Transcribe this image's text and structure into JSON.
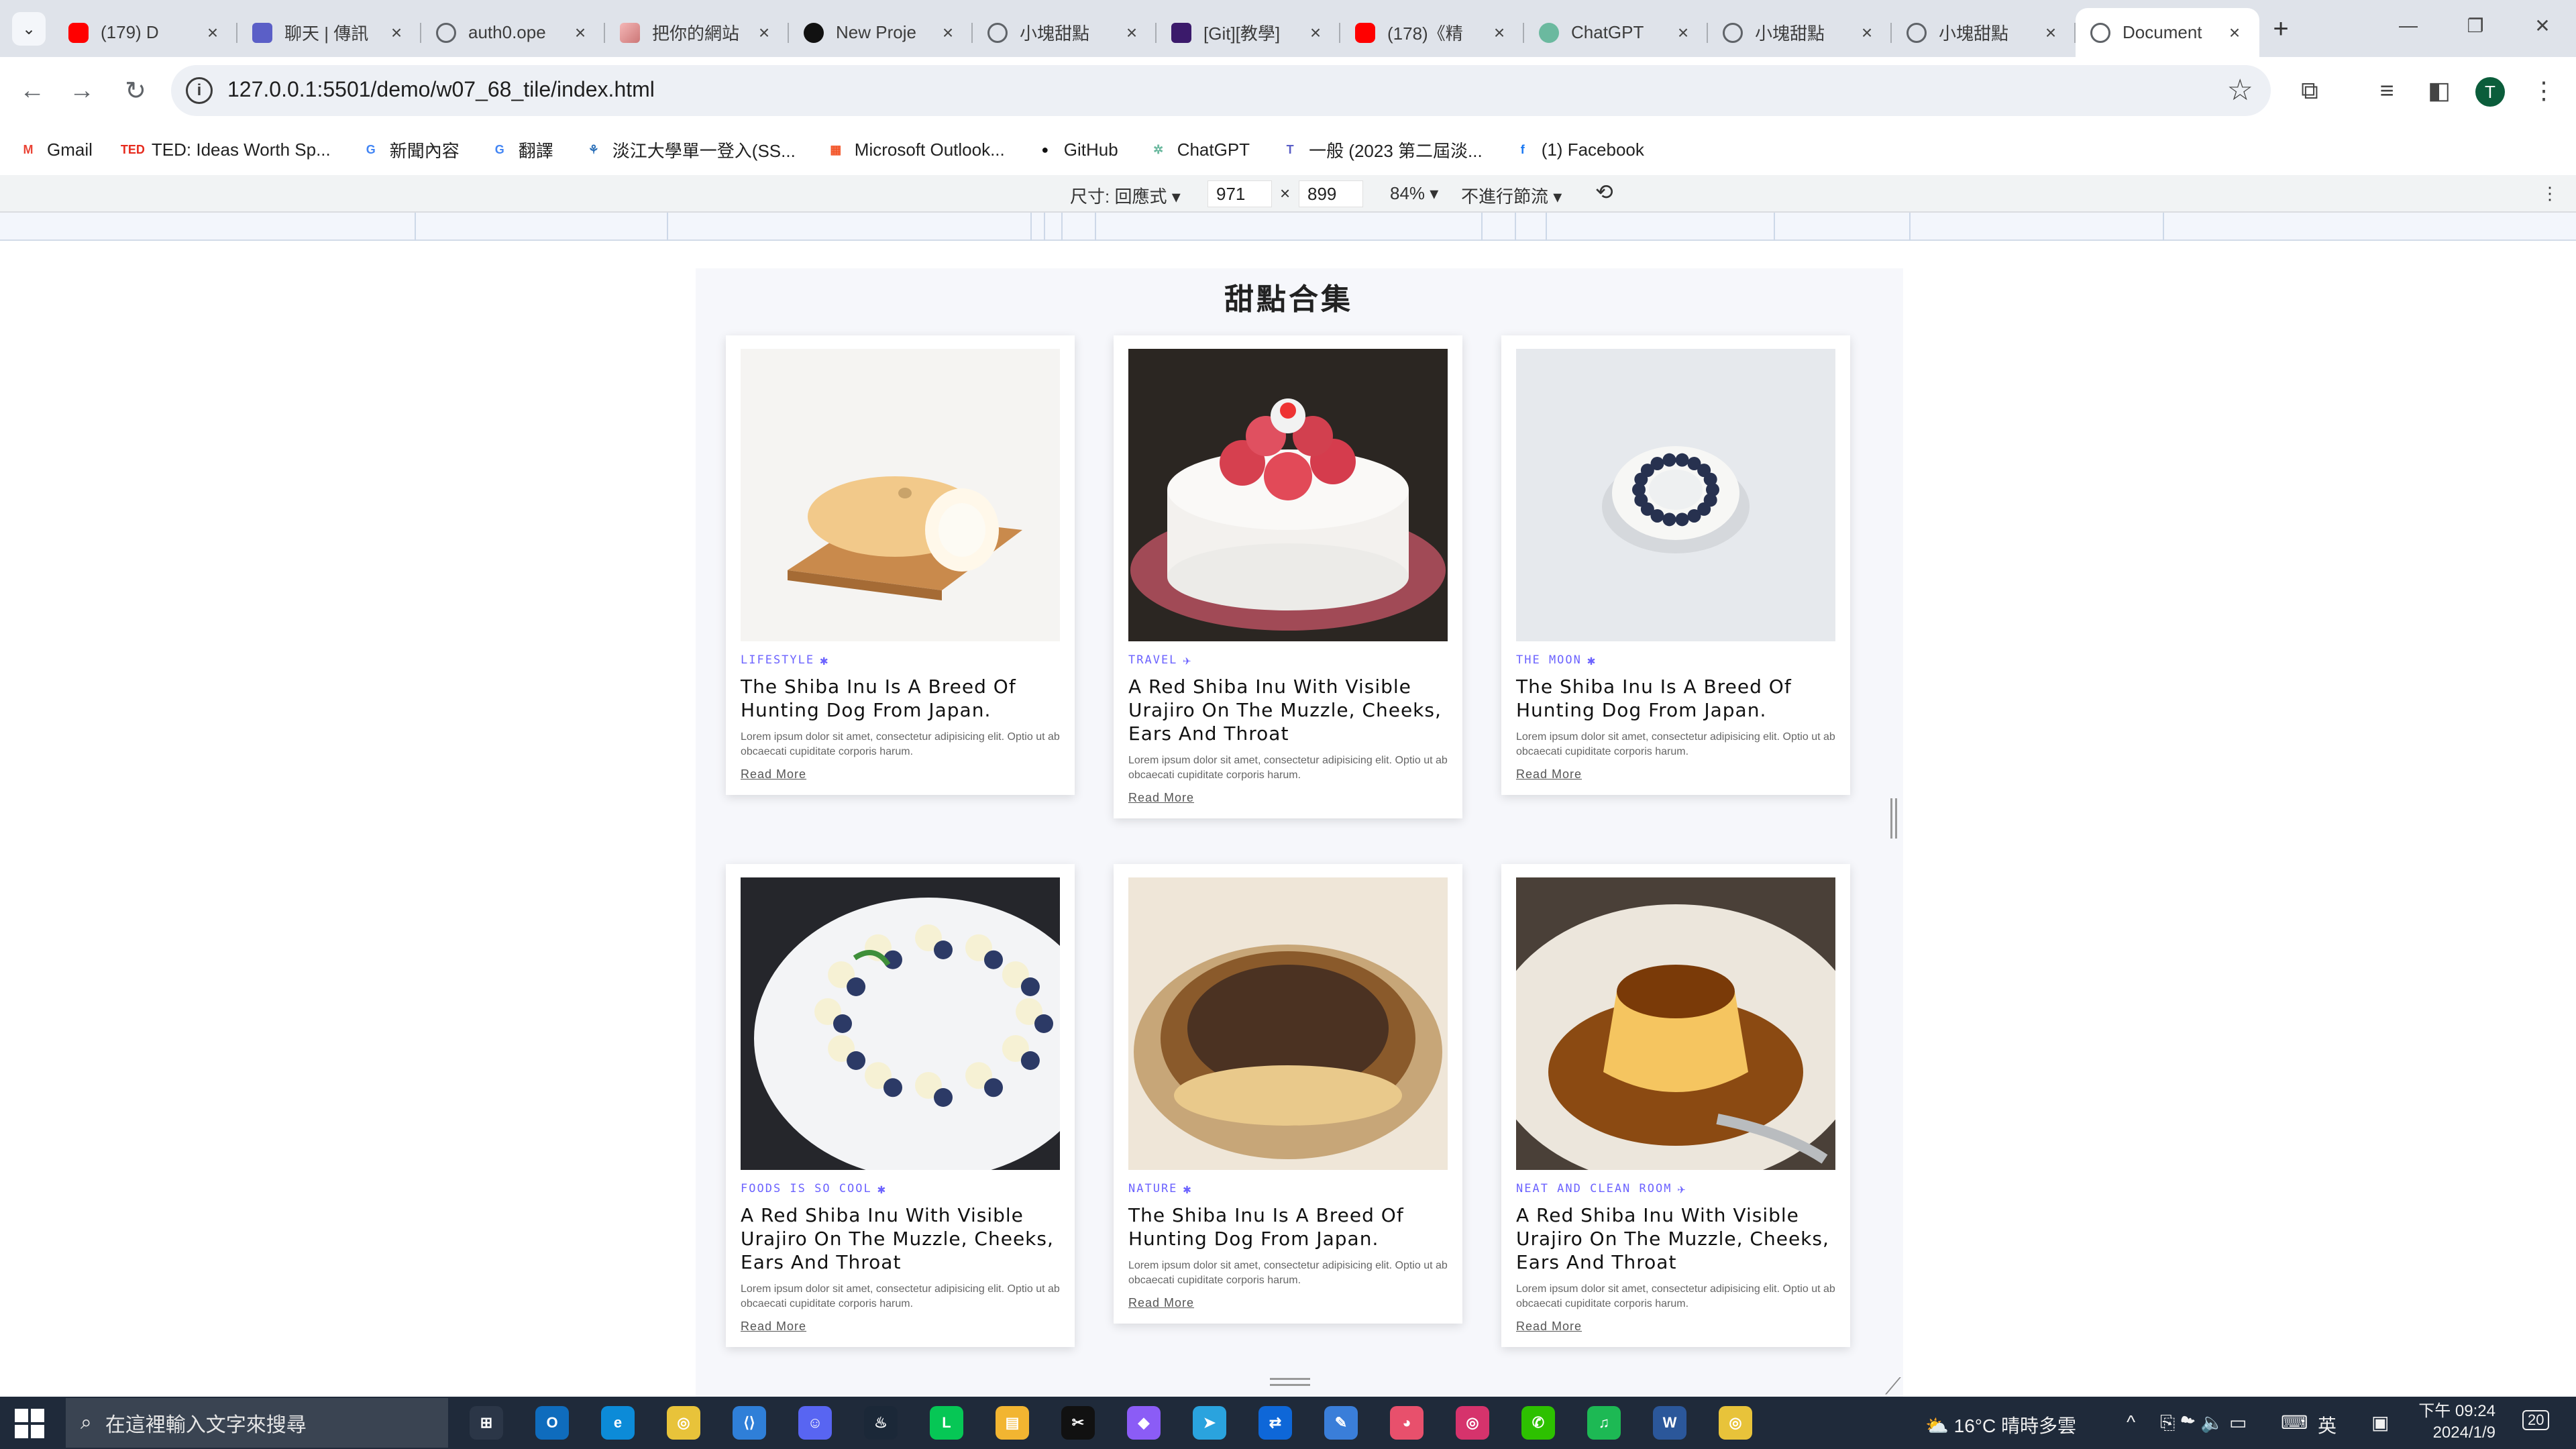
{
  "browser": {
    "tabs": [
      {
        "title": "(179) D",
        "icon": "youtube-icon",
        "favicon_class": "fav-yt"
      },
      {
        "title": "聊天 | 傳訊",
        "icon": "teams-icon",
        "favicon_class": "fav-teams"
      },
      {
        "title": "auth0.ope",
        "icon": "globe-icon",
        "favicon_class": "fav-globe"
      },
      {
        "title": "把你的網站",
        "icon": "site-icon",
        "favicon_class": "fav-pink"
      },
      {
        "title": "New Proje",
        "icon": "vercel-icon",
        "favicon_class": "fav-black"
      },
      {
        "title": "小塊甜點",
        "icon": "globe-icon",
        "favicon_class": "fav-globe"
      },
      {
        "title": "[Git][教學]",
        "icon": "site-icon",
        "favicon_class": "fav-purple"
      },
      {
        "title": "(178)《精",
        "icon": "youtube-icon",
        "favicon_class": "fav-yt"
      },
      {
        "title": "ChatGPT",
        "icon": "chatgpt-icon",
        "favicon_class": "fav-gpt"
      },
      {
        "title": "小塊甜點",
        "icon": "globe-icon",
        "favicon_class": "fav-globe"
      },
      {
        "title": "小塊甜點",
        "icon": "globe-icon",
        "favicon_class": "fav-globe"
      },
      {
        "title": "Document",
        "icon": "globe-icon",
        "favicon_class": "fav-globe",
        "active": true
      }
    ],
    "url": "127.0.0.1:5501/demo/w07_68_tile/index.html",
    "profile_initial": "T",
    "bookmarks": [
      {
        "label": "Gmail",
        "icon": "M",
        "color": "#ea4335"
      },
      {
        "label": "TED: Ideas Worth Sp...",
        "icon": "TED",
        "color": "#e62b1e"
      },
      {
        "label": "新聞內容",
        "icon": "G",
        "color": "#4285f4"
      },
      {
        "label": "翻譯",
        "icon": "G",
        "color": "#4285f4"
      },
      {
        "label": "淡江大學單一登入(SS...",
        "icon": "⚘",
        "color": "#2a6fb8"
      },
      {
        "label": "Microsoft Outlook...",
        "icon": "▦",
        "color": "#f25022"
      },
      {
        "label": "GitHub",
        "icon": "●",
        "color": "#111111"
      },
      {
        "label": "ChatGPT",
        "icon": "✲",
        "color": "#6bb99f"
      },
      {
        "label": "一般 (2023 第二屆淡...",
        "icon": "T",
        "color": "#5b5fc7"
      },
      {
        "label": "(1) Facebook",
        "icon": "f",
        "color": "#1877f2"
      }
    ]
  },
  "devtools": {
    "dimensions_label": "尺寸: 回應式",
    "width_value": "971",
    "times": "×",
    "height_value": "899",
    "zoom": "84%",
    "throttle": "不進行節流"
  },
  "page": {
    "title": "甜點合集",
    "cards": [
      {
        "category": "LIFESTYLE",
        "cat_icon": "✱",
        "title": "The Shiba Inu Is A Breed Of Hunting Dog From Japan.",
        "text": "Lorem ipsum dolor sit amet, consectetur adipisicing elit. Optio ut ab obcaecati cupiditate corporis harum.",
        "link": "Read More",
        "image": "roll-cake"
      },
      {
        "category": "TRAVEL",
        "cat_icon": "✈",
        "title": "A Red Shiba Inu With Visible Urajiro On The Muzzle, Cheeks, Ears And Throat",
        "text": "Lorem ipsum dolor sit amet, consectetur adipisicing elit. Optio ut ab obcaecati cupiditate corporis harum.",
        "link": "Read More",
        "image": "strawberry-cake"
      },
      {
        "category": "THE MOON",
        "cat_icon": "✱",
        "title": "The Shiba Inu Is A Breed Of Hunting Dog From Japan.",
        "text": "Lorem ipsum dolor sit amet, consectetur adipisicing elit. Optio ut ab obcaecati cupiditate corporis harum.",
        "link": "Read More",
        "image": "blueberry-tart"
      },
      {
        "category": "FOODS IS SO COOL",
        "cat_icon": "✱",
        "title": "A Red Shiba Inu With Visible Urajiro On The Muzzle, Cheeks, Ears And Throat",
        "text": "Lorem ipsum dolor sit amet, consectetur adipisicing elit. Optio ut ab obcaecati cupiditate corporis harum.",
        "link": "Read More",
        "image": "blueberry-cream-cake"
      },
      {
        "category": "NATURE",
        "cat_icon": "✱",
        "title": "The Shiba Inu Is A Breed Of Hunting Dog From Japan.",
        "text": "Lorem ipsum dolor sit amet, consectetur adipisicing elit. Optio ut ab obcaecati cupiditate corporis harum.",
        "link": "Read More",
        "image": "basque-cheesecake"
      },
      {
        "category": "NEAT AND CLEAN ROOM",
        "cat_icon": "✈",
        "title": "A Red Shiba Inu With Visible Urajiro On The Muzzle, Cheeks, Ears And Throat",
        "text": "Lorem ipsum dolor sit amet, consectetur adipisicing elit. Optio ut ab obcaecati cupiditate corporis harum.",
        "link": "Read More",
        "image": "caramel-pudding"
      }
    ]
  },
  "taskbar": {
    "search_placeholder": "在這裡輸入文字來搜尋",
    "weather": "16°C 晴時多雲",
    "ime": "英",
    "time": "下午 09:24",
    "date": "2024/1/9",
    "notification_count": "20",
    "apps": [
      "task-view",
      "outlook",
      "edge",
      "chrome",
      "vscode",
      "discord",
      "steam",
      "line",
      "file-explorer",
      "capcut",
      "github-desktop",
      "telegram",
      "teamviewer",
      "notepad",
      "paint",
      "instagram",
      "wechat",
      "spotify",
      "word",
      "chrome-2"
    ]
  }
}
